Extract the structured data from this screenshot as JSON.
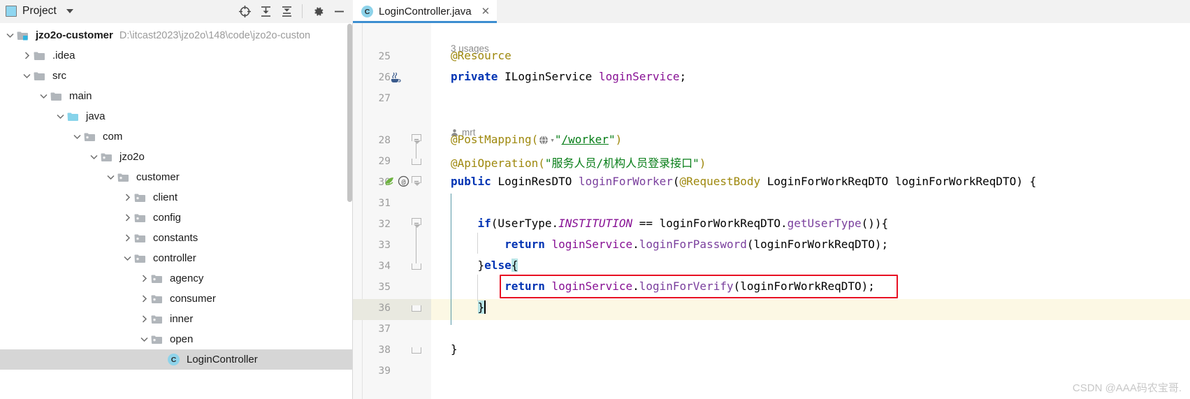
{
  "panel": {
    "title": "Project",
    "icon": "project-window-icon",
    "tools": [
      {
        "name": "locate-icon",
        "label": "Select Opened File"
      },
      {
        "name": "expand-all-icon",
        "label": "Expand All"
      },
      {
        "name": "collapse-all-icon",
        "label": "Collapse All"
      },
      {
        "name": "gear-icon",
        "label": "Settings"
      },
      {
        "name": "minimize-icon",
        "label": "Hide"
      }
    ]
  },
  "tree": [
    {
      "label": "jzo2o-customer",
      "path": "D:\\itcast2023\\jzo2o\\148\\code\\jzo2o-custon",
      "depth": 0,
      "state": "expanded",
      "icon": "module-folder",
      "bold": true,
      "selected": false
    },
    {
      "label": ".idea",
      "path": "",
      "depth": 1,
      "state": "collapsed",
      "icon": "folder",
      "bold": false,
      "selected": false
    },
    {
      "label": "src",
      "path": "",
      "depth": 1,
      "state": "expanded",
      "icon": "folder",
      "bold": false,
      "selected": false
    },
    {
      "label": "main",
      "path": "",
      "depth": 2,
      "state": "expanded",
      "icon": "folder",
      "bold": false,
      "selected": false
    },
    {
      "label": "java",
      "path": "",
      "depth": 3,
      "state": "expanded",
      "icon": "source-folder",
      "bold": false,
      "selected": false
    },
    {
      "label": "com",
      "path": "",
      "depth": 4,
      "state": "expanded",
      "icon": "package",
      "bold": false,
      "selected": false
    },
    {
      "label": "jzo2o",
      "path": "",
      "depth": 5,
      "state": "expanded",
      "icon": "package",
      "bold": false,
      "selected": false
    },
    {
      "label": "customer",
      "path": "",
      "depth": 6,
      "state": "expanded",
      "icon": "package",
      "bold": false,
      "selected": false
    },
    {
      "label": "client",
      "path": "",
      "depth": 7,
      "state": "collapsed",
      "icon": "package",
      "bold": false,
      "selected": false
    },
    {
      "label": "config",
      "path": "",
      "depth": 7,
      "state": "collapsed",
      "icon": "package",
      "bold": false,
      "selected": false
    },
    {
      "label": "constants",
      "path": "",
      "depth": 7,
      "state": "collapsed",
      "icon": "package",
      "bold": false,
      "selected": false
    },
    {
      "label": "controller",
      "path": "",
      "depth": 7,
      "state": "expanded",
      "icon": "package",
      "bold": false,
      "selected": false
    },
    {
      "label": "agency",
      "path": "",
      "depth": 8,
      "state": "collapsed",
      "icon": "package",
      "bold": false,
      "selected": false
    },
    {
      "label": "consumer",
      "path": "",
      "depth": 8,
      "state": "collapsed",
      "icon": "package",
      "bold": false,
      "selected": false
    },
    {
      "label": "inner",
      "path": "",
      "depth": 8,
      "state": "collapsed",
      "icon": "package",
      "bold": false,
      "selected": false
    },
    {
      "label": "open",
      "path": "",
      "depth": 8,
      "state": "expanded",
      "icon": "package",
      "bold": false,
      "selected": false
    },
    {
      "label": "LoginController",
      "path": "",
      "depth": 9,
      "state": "leaf",
      "icon": "java-class",
      "bold": false,
      "selected": true
    }
  ],
  "editor": {
    "tab": {
      "label": "LoginController.java",
      "icon": "java-class",
      "close": "✕",
      "active": true
    },
    "hints": {
      "usages": "3 usages",
      "author": "mrt"
    },
    "lines": [
      {
        "num": "25",
        "text": "@Resource",
        "fold": "none"
      },
      {
        "num": "26",
        "text": "private ILoginService loginService;",
        "fold": "none",
        "gutter": "java-bean-icon"
      },
      {
        "num": "27",
        "text": "",
        "fold": "none"
      },
      {
        "num": "28",
        "text": "@PostMapping(\"/worker\")",
        "fold": "start-arrow"
      },
      {
        "num": "29",
        "text": "@ApiOperation(\"服务人员/机构人员登录接口\")",
        "fold": "end"
      },
      {
        "num": "30",
        "text": "public LoginResDTO loginForWorker(@RequestBody LoginForWorkReqDTO loginForWorkReqDTO) {",
        "fold": "plain",
        "gutter": "spring-bean-icon,override-icon"
      },
      {
        "num": "31",
        "text": "",
        "fold": "none"
      },
      {
        "num": "32",
        "text": "    if(UserType.INSTITUTION == loginForWorkReqDTO.getUserType()){",
        "fold": "start-arrow"
      },
      {
        "num": "33",
        "text": "        return loginService.loginForPassword(loginForWorkReqDTO);",
        "fold": "none"
      },
      {
        "num": "34",
        "text": "    }else{",
        "fold": "end"
      },
      {
        "num": "35",
        "text": "        return loginService.loginForVerify(loginForWorkReqDTO);",
        "fold": "none"
      },
      {
        "num": "36",
        "text": "    }",
        "fold": "end",
        "current": true
      },
      {
        "num": "37",
        "text": "",
        "fold": "none"
      },
      {
        "num": "38",
        "text": "}",
        "fold": "end"
      },
      {
        "num": "39",
        "text": "",
        "fold": "none"
      }
    ],
    "annotation": {
      "type": "red-rectangle",
      "color": "#e81123",
      "target_line": "35"
    },
    "mapping_url": "/worker",
    "api_description": "服务人员/机构人员登录接口"
  },
  "watermark": "CSDN @AAA码农宝哥."
}
